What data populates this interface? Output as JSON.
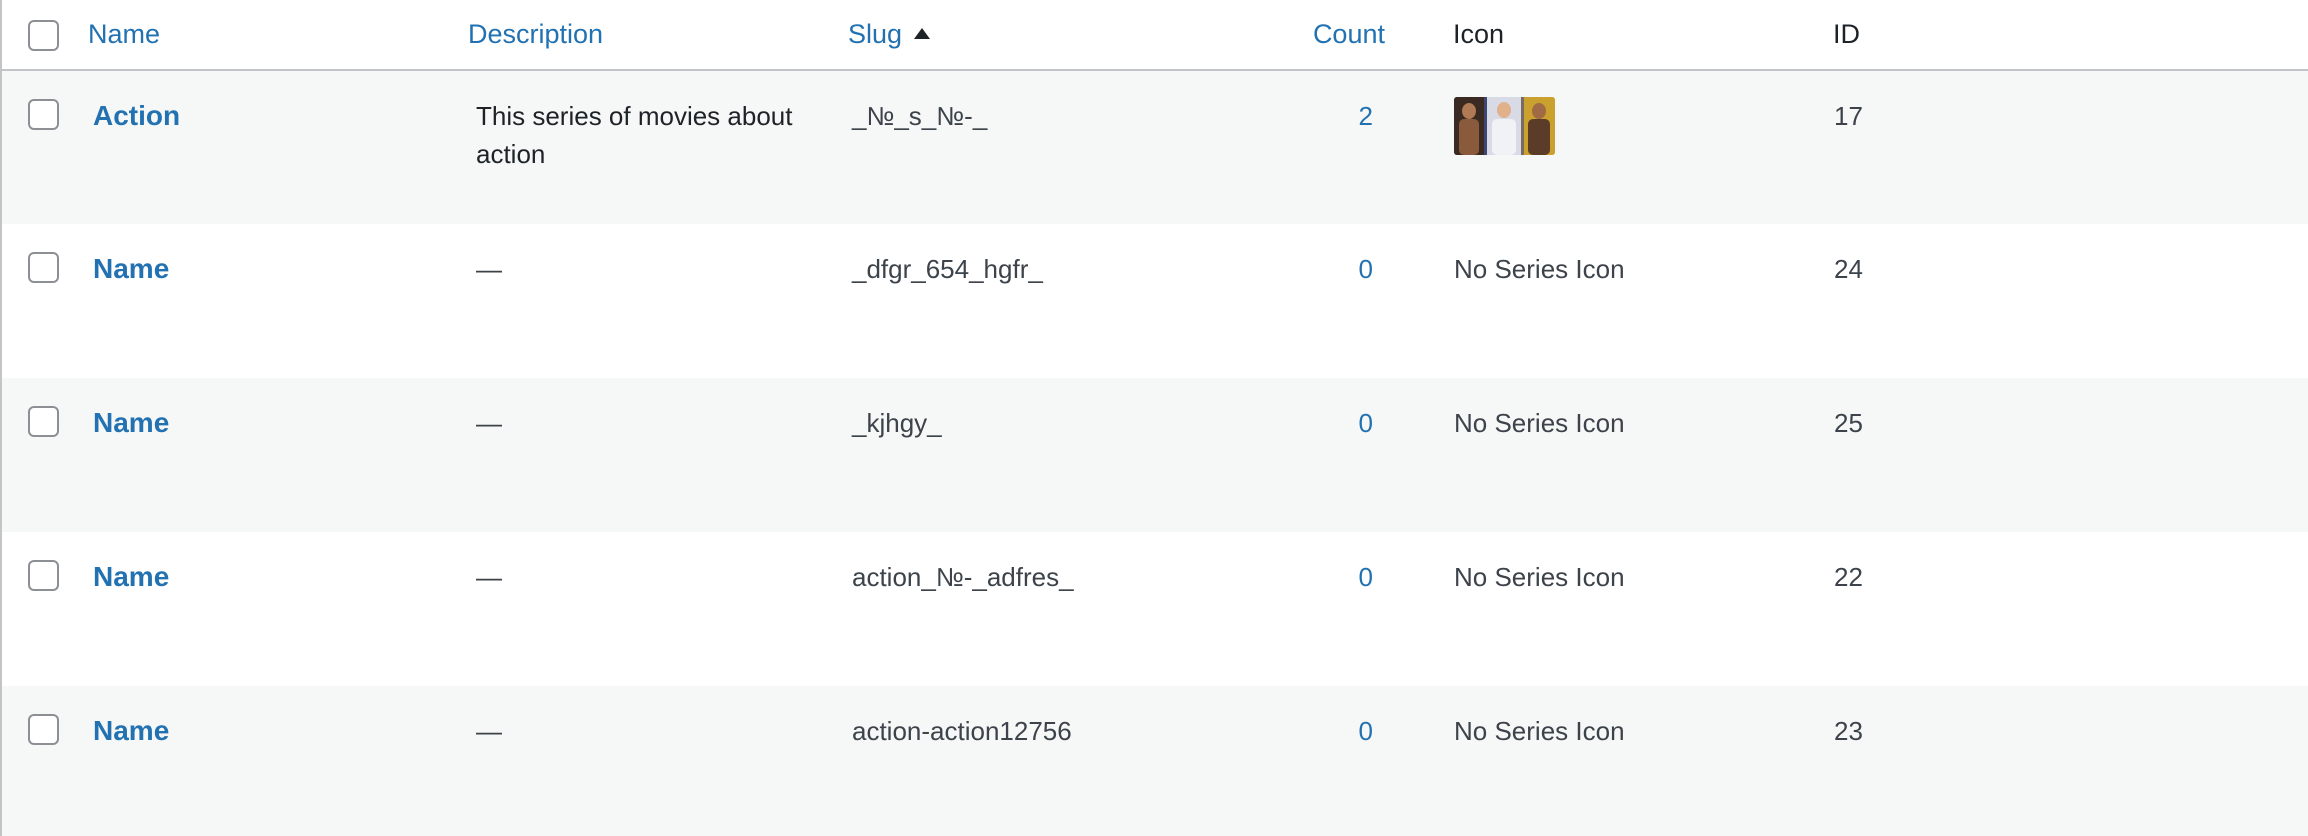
{
  "table": {
    "columns": {
      "name": "Name",
      "description": "Description",
      "slug": "Slug",
      "count": "Count",
      "icon": "Icon",
      "id": "ID"
    },
    "rows": [
      {
        "name": "Action",
        "description": "This series of movies about action",
        "slug": "_№_s_№-_",
        "count": "2",
        "icon": "action-heroes-thumbnail",
        "id": "17"
      },
      {
        "name": "Name",
        "description": "—",
        "slug": "_dfgr_654_hgfr_",
        "count": "0",
        "icon": "No Series Icon",
        "id": "24"
      },
      {
        "name": "Name",
        "description": "—",
        "slug": "_kjhgy_",
        "count": "0",
        "icon": "No Series Icon",
        "id": "25"
      },
      {
        "name": "Name",
        "description": "—",
        "slug": "action_№-_adfres_",
        "count": "0",
        "icon": "No Series Icon",
        "id": "22"
      },
      {
        "name": "Name",
        "description": "—",
        "slug": "action-action12756",
        "count": "0",
        "icon": "No Series Icon",
        "id": "23"
      }
    ]
  },
  "colors": {
    "link": "#2271b1",
    "row_alt": "#f6f7f7",
    "border": "#c3c4c7"
  }
}
